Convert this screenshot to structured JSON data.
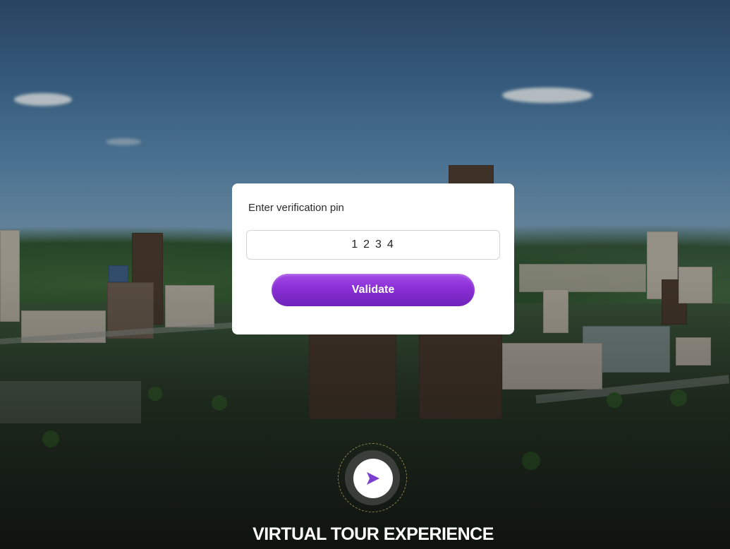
{
  "verification": {
    "label": "Enter verification pin",
    "pin_value": "1234",
    "validate_label": "Validate"
  },
  "tour": {
    "play_icon": "play-icon",
    "title": "VIRTUAL TOUR EXPERIENCE"
  },
  "colors": {
    "accent": "#8a2fd6",
    "play_icon": "#7b3fd0"
  }
}
